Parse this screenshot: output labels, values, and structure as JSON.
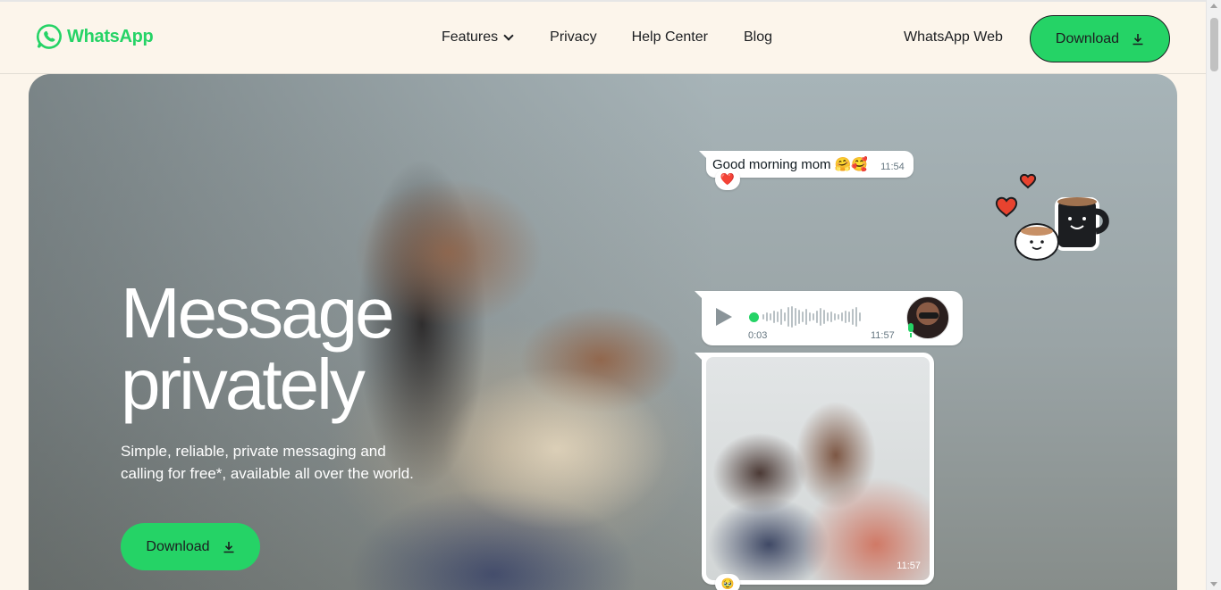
{
  "header": {
    "logo_text": "WhatsApp",
    "nav": {
      "features": "Features",
      "privacy": "Privacy",
      "help_center": "Help Center",
      "blog": "Blog"
    },
    "web_link": "WhatsApp Web",
    "download_label": "Download"
  },
  "hero": {
    "headline_line1": "Message",
    "headline_line2": "privately",
    "subtext": "Simple, reliable, private messaging and calling for free*, available all over the world.",
    "download_label": "Download"
  },
  "chat": {
    "message_text": "Good morning mom 🤗🥰",
    "message_time": "11:54",
    "message_reaction": "❤️",
    "voice_duration": "0:03",
    "voice_time": "11:57",
    "photo_time": "11:57",
    "photo_reaction": "🥹"
  },
  "colors": {
    "brand_green": "#25d366",
    "page_background": "#fcf5eb",
    "text_dark": "#1c1e21"
  },
  "icons": [
    "whatsapp-logo-icon",
    "chevron-down-icon",
    "download-icon",
    "play-icon",
    "mic-icon",
    "coffee-sticker-icon",
    "heart-icon"
  ]
}
